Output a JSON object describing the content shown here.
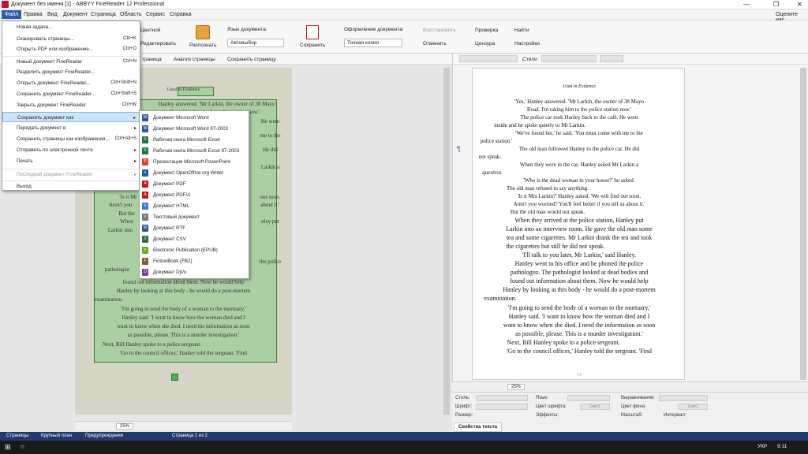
{
  "window": {
    "title": "Документ без имени [1] - ABBYY FineReader 12 Professional",
    "controls": [
      "—",
      "❐",
      "✕"
    ]
  },
  "menu": {
    "items": [
      "Файл",
      "Правка",
      "Вид",
      "Документ",
      "Страница",
      "Область",
      "Сервис",
      "Справка"
    ],
    "rate": "Оцените нас"
  },
  "toolbar": {
    "color": "Цветной",
    "edit": "Редактировать",
    "recognize": "Распознать",
    "lang_label": "Язык документа:",
    "lang_value": "Автовыбор",
    "save": "Сохранить",
    "layout_label": "Оформление документа:",
    "layout_value": "Точная копия",
    "restore": "Восстановить",
    "cancel": "Отменить",
    "check": "Проверка",
    "find": "Найти",
    "censor": "Цензура",
    "settings": "Настройки"
  },
  "left_toolbar": {
    "page": "траница",
    "analyze": "Анализ страницы",
    "save_page": "Сохранить страницу"
  },
  "right_toolbar": {
    "styles": "Стили"
  },
  "file_menu": [
    {
      "label": "Новая задача...",
      "shortcut": ""
    },
    {
      "label": "Сканировать страницы...",
      "shortcut": "Ctrl+K"
    },
    {
      "label": "Открыть PDF или изображение...",
      "shortcut": "Ctrl+O"
    },
    {
      "label": "Новый документ FineReader",
      "shortcut": "Ctrl+N"
    },
    {
      "label": "Разделить документ FineReader...",
      "shortcut": ""
    },
    {
      "label": "Открыть документ FineReader...",
      "shortcut": "Ctrl+Shift+N"
    },
    {
      "label": "Сохранить документ FineReader...",
      "shortcut": "Ctrl+Shift+S"
    },
    {
      "label": "Закрыть документ FineReader",
      "shortcut": "Ctrl+W"
    },
    {
      "label": "Сохранить документ как",
      "shortcut": "▸"
    },
    {
      "label": "Передать документ в",
      "shortcut": "▸"
    },
    {
      "label": "Сохранить страницы как изображения...",
      "shortcut": "Ctrl+Alt+S"
    },
    {
      "label": "Отправить по электронной почте",
      "shortcut": "▸"
    },
    {
      "label": "Печать",
      "shortcut": "▸"
    },
    {
      "label": "Последний документ FineReader",
      "shortcut": "▸"
    },
    {
      "label": "Выход",
      "shortcut": ""
    }
  ],
  "save_as_menu": [
    {
      "label": "Документ Microsoft Word",
      "icon": "W",
      "color": "#2b579a"
    },
    {
      "label": "Документ Microsoft Word 97-2003",
      "icon": "W",
      "color": "#2b579a"
    },
    {
      "label": "Рабочая книга Microsoft Excel",
      "icon": "X",
      "color": "#217346"
    },
    {
      "label": "Рабочая книга Microsoft Excel 97-2003",
      "icon": "X",
      "color": "#217346"
    },
    {
      "label": "Презентация Microsoft PowerPoint",
      "icon": "P",
      "color": "#d24726"
    },
    {
      "label": "Документ OpenOffice.org Writer",
      "icon": "≡",
      "color": "#1d5fa3"
    },
    {
      "label": "Документ PDF",
      "icon": "A",
      "color": "#c4161c"
    },
    {
      "label": "Документ PDF/A",
      "icon": "A",
      "color": "#c4161c"
    },
    {
      "label": "Документ HTML",
      "icon": "e",
      "color": "#3a7bd5"
    },
    {
      "label": "Текстовый документ",
      "icon": "≡",
      "color": "#777"
    },
    {
      "label": "Документ RTF",
      "icon": "W",
      "color": "#2b579a"
    },
    {
      "label": "Документ CSV",
      "icon": "X",
      "color": "#217346"
    },
    {
      "label": "Electronic Publication (EPUB)",
      "icon": "e",
      "color": "#6aaa2a"
    },
    {
      "label": "FictionBook (FB2)",
      "icon": "F",
      "color": "#8a5a2b"
    },
    {
      "label": "Документ DjVu",
      "icon": "D",
      "color": "#7b3fa0"
    }
  ],
  "scan_lines": [
    "Used in Evidence",
    "Hanley answered. 'Mr Larkin, the owner of 38 Mayo",
    "I'm taking him to the police station now.'",
    "He went",
    "me to the",
    "He did",
    "Larkin a",
    "'Is it Mr",
    "out soon.",
    "Aren't you",
    "about it.'",
    "But the",
    "When",
    "nley put",
    "Larkin into",
    "the police",
    "pathologist",
    "found out information about them. Now he would help",
    "Hanley by looking at this body - he would do a post-mortem",
    "examination.",
    "'I'm going to send the body of a woman to the mortuary,'",
    "Hanley said. 'I want to know how the woman died and I",
    "want to know when she died. I need the information as soon",
    "as possible, please. This is a murder investigation.'",
    "Next, Bill Hanley spoke to a police sergeant.",
    "'Go to the council offices,' Hanley told the sergeant. 'Find"
  ],
  "doc_lines": [
    "Used in Evidence",
    "'Yes,' Hanley answered. 'Mr Larkin, the owner of 38 Mayo",
    "Road. I'm taking him to the police station now.'",
    "The police car took Hanley back to the café. He went",
    "inside and he spoke quietly to Mr Larkin.",
    "'We've found her,' he said. 'You must come with me to the",
    "police station.'",
    "The old man followed Hanley to the police car. He did",
    "not speak.",
    "When they were in the car, Hanley asked Mr Larkin a",
    "question.",
    "'Who is the dead woman in your house?' he asked.",
    "The old man refused to say anything.",
    "'Is it Mrs Larkin?' Hanley asked. 'We will find out soon.",
    "Aren't you worried? You'll feel better if you tell us about it.'",
    "But the old man would not speak.",
    "When they arrived at the police station, Hanley put",
    "Larkin into an interview room. He gave the old man some",
    "tea and some cigarettes. Mr Larkin drank the tea and took",
    "the cigarettes but still he did not speak.",
    "'I'll talk to you later, Mr Larkin,' said Hanley.",
    "Hanley went to his office and he phoned the police",
    "pathologist. The pathologist looked at dead bodies and",
    "found out information about them. Now he would help",
    "Hanley by looking at this body - he would do a post-mortem",
    "examination.",
    "'I'm going to send the body of a woman to the mortuary,'",
    "Hanley said. 'I want to know how the woman died and I",
    "want to know when she died. I need the information as soon",
    "as possible, please. This is a murder investigation.'",
    "Next, Bill Hanley spoke to a police sergeant.",
    "'Go to the council offices,' Hanley told the sergeant. 'Find"
  ],
  "page_number": "14",
  "zoom": {
    "left": "25%",
    "right": "25%"
  },
  "props": {
    "style": "Стиль:",
    "font": "Шрифт:",
    "size": "Размер:",
    "lang": "Язык:",
    "font_color": "Цвет шрифта:",
    "effects": "Эффекты:",
    "align": "Выравнивание:",
    "bg": "Цвет фона:",
    "scale": "Масштаб:",
    "interval": "Интервал:",
    "none1": "(нет)",
    "none2": "(нет)",
    "tab": "Свойства текста"
  },
  "status": {
    "pages": "Страницы",
    "zoom": "Крупный план",
    "warnings": "Предупреждения",
    "page": "Страница 1 из 2"
  },
  "taskbar": {
    "time": "9:11",
    "lang": "УКР"
  }
}
